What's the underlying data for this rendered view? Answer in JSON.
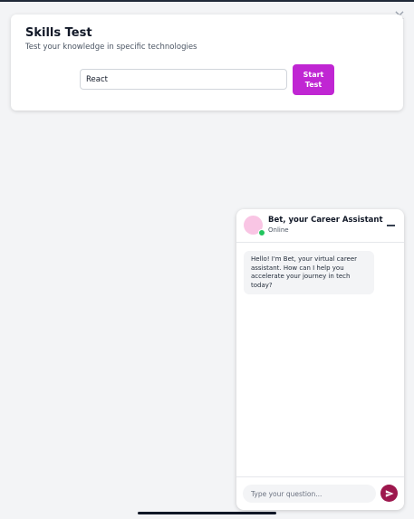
{
  "skills_test": {
    "title": "Skills Test",
    "subtitle": "Test your knowledge in specific technologies",
    "input_value": "React",
    "start_button_label": "Start Test",
    "close_symbol": "×"
  },
  "chat": {
    "title": "Bet, your Career Assistant",
    "status": "Online",
    "messages": [
      {
        "sender": "assistant",
        "text": "Hello! I'm Bet, your virtual career assistant. How can I help you accelerate your journey in tech today?"
      }
    ],
    "input_placeholder": "Type your question...",
    "icons": {
      "minimize": "minimize-icon",
      "send": "send-icon"
    }
  },
  "colors": {
    "accent": "#c026d3",
    "send": "#9d174d",
    "avatar": "#f9c5e4",
    "online": "#22c55e"
  }
}
